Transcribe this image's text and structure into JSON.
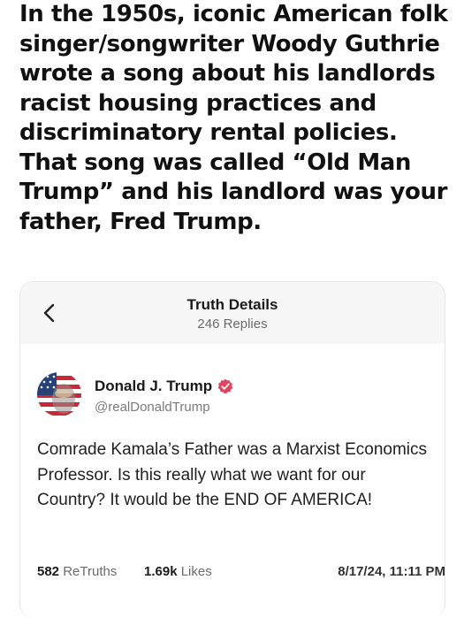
{
  "headline": "In the 1950s, iconic American folk singer/songwriter Woody Guthrie wrote a song about his landlords racist housing practices and discriminatory rental policies. That song was called “Old Man Trump” and his landlord was your father, Fred Trump.",
  "card": {
    "header_title": "Truth Details",
    "header_subtitle": "246 Replies",
    "author_name": "Donald J. Trump",
    "author_handle": "@realDonaldTrump",
    "post_text": "Comrade Kamala’s Father was a Marxist Economics Professor. Is this really what we want for our Country? It would be the END OF AMERICA!",
    "retruths_count": "582",
    "retruths_label": "ReTruths",
    "likes_count": "1.69k",
    "likes_label": "Likes",
    "timestamp": "8/17/24, 11:11 PM"
  },
  "icons": {
    "back": "chevron-left-icon",
    "verified": "verified-badge-icon"
  },
  "colors": {
    "verified_badge": "#e0455f",
    "header_bg": "#f7f7f7"
  }
}
